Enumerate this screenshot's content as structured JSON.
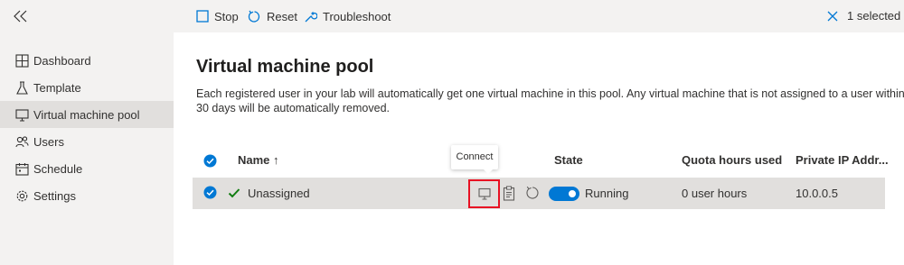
{
  "toolbar": {
    "stop_label": "Stop",
    "reset_label": "Reset",
    "troubleshoot_label": "Troubleshoot",
    "selection_text": "1 selected"
  },
  "sidebar": {
    "items": [
      {
        "label": "Dashboard",
        "icon": "dashboard-icon"
      },
      {
        "label": "Template",
        "icon": "flask-icon"
      },
      {
        "label": "Virtual machine pool",
        "icon": "monitor-icon",
        "active": true
      },
      {
        "label": "Users",
        "icon": "users-icon"
      },
      {
        "label": "Schedule",
        "icon": "calendar-icon"
      },
      {
        "label": "Settings",
        "icon": "gear-icon"
      }
    ]
  },
  "main": {
    "title": "Virtual machine pool",
    "description": "Each registered user in your lab will automatically get one virtual machine in this pool. Any virtual machine that is not assigned to a user within 30 days will be automatically removed.",
    "tooltip": "Connect",
    "columns": {
      "name": "Name ↑",
      "state": "State",
      "quota": "Quota hours used",
      "ip": "Private IP Addr..."
    },
    "rows": [
      {
        "name": "Unassigned",
        "state": "Running",
        "quota": "0 user hours",
        "ip": "10.0.0.5",
        "selected": true,
        "toggle_on": true
      }
    ]
  },
  "colors": {
    "accent": "#0078d4",
    "status_green": "#107c10",
    "highlight_red": "#e81123",
    "chrome": "#f3f2f1",
    "selected_row": "#e1dfdd"
  }
}
